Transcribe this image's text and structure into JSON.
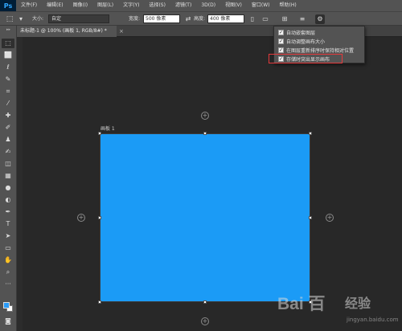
{
  "app": {
    "logo": "Ps"
  },
  "menu": [
    "文件(F)",
    "编辑(E)",
    "图像(I)",
    "图层(L)",
    "文字(Y)",
    "选择(S)",
    "滤镜(T)",
    "3D(D)",
    "视图(V)",
    "窗口(W)",
    "帮助(H)"
  ],
  "options": {
    "tool_glyph": "⬚",
    "size_label": "大小:",
    "size_value": "自定",
    "width_label": "宽度:",
    "width_value": "500 像素",
    "height_label": "高度:",
    "height_value": "400 像素"
  },
  "document": {
    "tab_title": "未标题-1 @ 100% (画板 1, RGB/8#) *",
    "close": "×"
  },
  "artboard": {
    "label": "画板 1",
    "fill": "#1b9bf6"
  },
  "dropdown": {
    "items": [
      {
        "label": "自动嵌套图层",
        "checked": true
      },
      {
        "label": "自动调整画布大小",
        "checked": true
      },
      {
        "label": "在图层重新排序时保持相对位置",
        "checked": true
      },
      {
        "label": "存储时突出显示画布",
        "checked": true
      }
    ],
    "highlight_color": "#e4393c"
  },
  "colors": {
    "foreground": "#2a9bf8",
    "background": "#ffffff"
  },
  "watermark": {
    "logo": "Bai 百",
    "brand": "经验",
    "url": "jingyan.baidu.com"
  }
}
